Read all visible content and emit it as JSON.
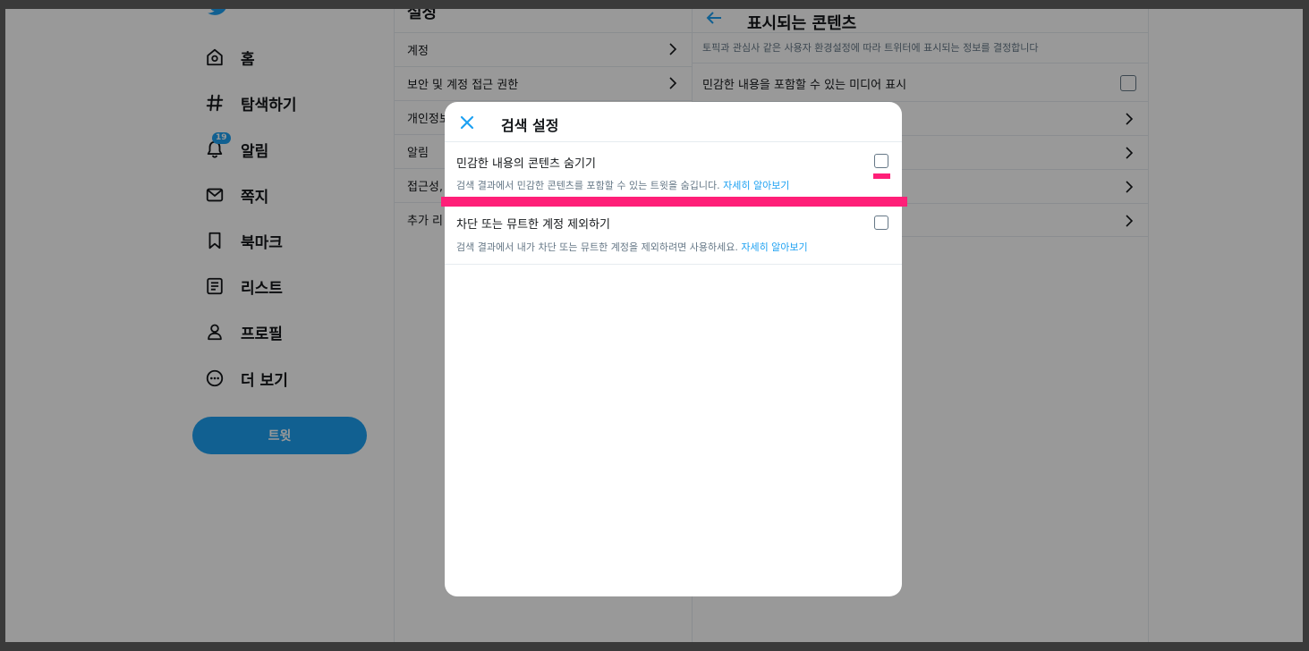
{
  "sidebar": {
    "items": [
      {
        "label": "홈",
        "icon": "home-icon"
      },
      {
        "label": "탐색하기",
        "icon": "hashtag-icon"
      },
      {
        "label": "알림",
        "icon": "bell-icon",
        "badge": "19"
      },
      {
        "label": "쪽지",
        "icon": "mail-icon"
      },
      {
        "label": "북마크",
        "icon": "bookmark-icon"
      },
      {
        "label": "리스트",
        "icon": "list-icon"
      },
      {
        "label": "프로필",
        "icon": "profile-icon"
      },
      {
        "label": "더 보기",
        "icon": "more-icon"
      }
    ],
    "tweet_button": "트윗"
  },
  "settings": {
    "title": "설정",
    "items": [
      "계정",
      "보안 및 계정 접근 권한",
      "개인정보",
      "알림",
      "접근성,",
      "추가 리"
    ]
  },
  "content": {
    "title": "표시되는 콘텐츠",
    "description": "토픽과 관심사 같은 사용자 환경설정에 따라 트위터에 표시되는 정보를 결정합니다",
    "sensitive_media_label": "민감한 내용을 포함할 수 있는 미디어 표시"
  },
  "modal": {
    "title": "검색 설정",
    "options": [
      {
        "title": "민감한 내용의 콘텐츠 숨기기",
        "description": "검색 결과에서 민감한 콘텐츠를 포함할 수 있는 트윗을 숨깁니다. ",
        "link": "자세히 알아보기",
        "checked": false
      },
      {
        "title": "차단 또는 뮤트한 계정 제외하기",
        "description": "검색 결과에서 내가 차단 또는 뮤트한 계정을 제외하려면 사용하세요. ",
        "link": "자세히 알아보기",
        "checked": false
      }
    ]
  },
  "colors": {
    "accent": "#1da1f2",
    "highlight": "#ff1f78"
  }
}
